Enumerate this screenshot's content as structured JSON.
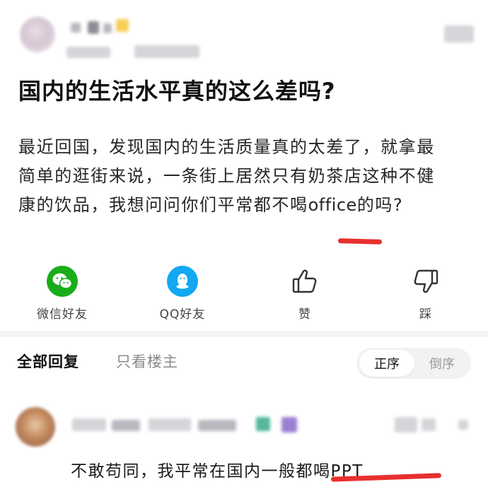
{
  "post": {
    "title": "国内的生活水平真的这么差吗?",
    "body_line1": "最近回国，发现国内的生活质量真的太差了，就拿最",
    "body_line2": "简单的逛街来说，一条街上居然只有奶茶店这种不健",
    "body_line3_prefix": "康的饮品，我想问问你们平常都不喝",
    "body_line3_highlight": "office",
    "body_line3_suffix": "的吗?"
  },
  "actions": [
    {
      "label": "微信好友",
      "icon": "wechat-icon",
      "color": "#1aad19"
    },
    {
      "label": "QQ好友",
      "icon": "qq-icon",
      "color": "#12a8f2"
    },
    {
      "label": "赞",
      "icon": "thumbs-up-icon"
    },
    {
      "label": "踩",
      "icon": "thumbs-down-icon"
    }
  ],
  "replies_header": {
    "tab_all": "全部回复",
    "tab_op": "只看楼主",
    "sort_asc": "正序",
    "sort_desc": "倒序"
  },
  "reply": {
    "text": "不敢苟同，我平常在国内一般都喝PPT"
  },
  "colors": {
    "underline_mark": "#e8302e",
    "wechat": "#1aad19",
    "qq": "#12a8f2"
  }
}
